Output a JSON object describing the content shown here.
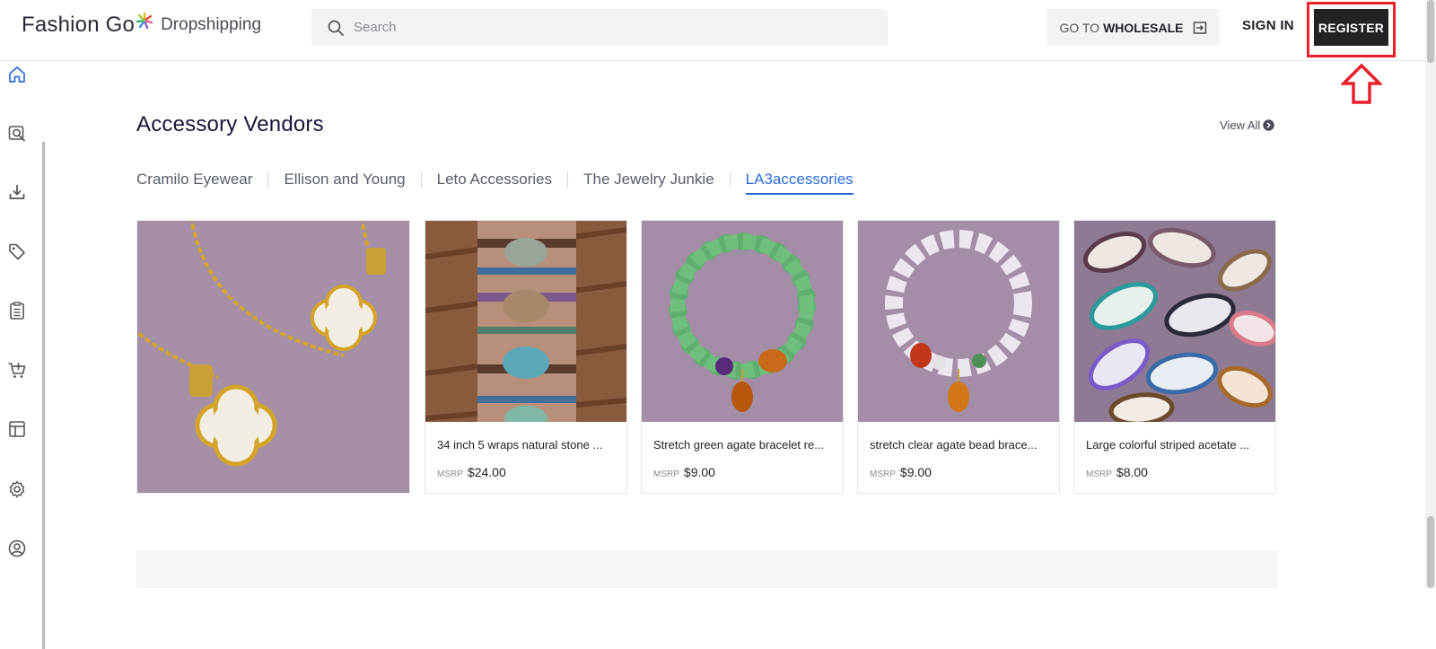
{
  "header": {
    "logo_main": "Fashion Go",
    "logo_sub": "Dropshipping",
    "search_placeholder": "Search",
    "wholesale_prefix": "GO TO",
    "wholesale_bold": "WHOLESALE",
    "signin_label": "SIGN IN",
    "register_label": "REGISTER"
  },
  "sidebar": {
    "items": [
      {
        "icon": "home-icon"
      },
      {
        "icon": "visual-search-icon"
      },
      {
        "icon": "download-icon"
      },
      {
        "icon": "tag-icon"
      },
      {
        "icon": "clipboard-icon"
      },
      {
        "icon": "cart-icon"
      },
      {
        "icon": "layout-icon"
      },
      {
        "icon": "settings-icon"
      },
      {
        "icon": "account-icon"
      }
    ]
  },
  "section": {
    "title": "Accessory Vendors",
    "view_all": "View All",
    "tabs": [
      {
        "label": "Cramilo Eyewear",
        "active": false
      },
      {
        "label": "Ellison and Young",
        "active": false
      },
      {
        "label": "Leto Accessories",
        "active": false
      },
      {
        "label": "The Jewelry Junkie",
        "active": false
      },
      {
        "label": "LA3accessories",
        "active": true
      }
    ]
  },
  "products": [
    {
      "name": "34 inch 5 wraps natural stone ...",
      "msrp_label": "MSRP",
      "price": "$24.00"
    },
    {
      "name": "Stretch green agate bracelet re...",
      "msrp_label": "MSRP",
      "price": "$9.00"
    },
    {
      "name": "stretch clear agate bead brace...",
      "msrp_label": "MSRP",
      "price": "$9.00"
    },
    {
      "name": "Large colorful striped acetate ...",
      "msrp_label": "MSRP",
      "price": "$8.00"
    }
  ],
  "colors": {
    "accent_blue": "#2a6cdb",
    "annotation_red": "#e8202a",
    "register_bg": "#222226"
  }
}
